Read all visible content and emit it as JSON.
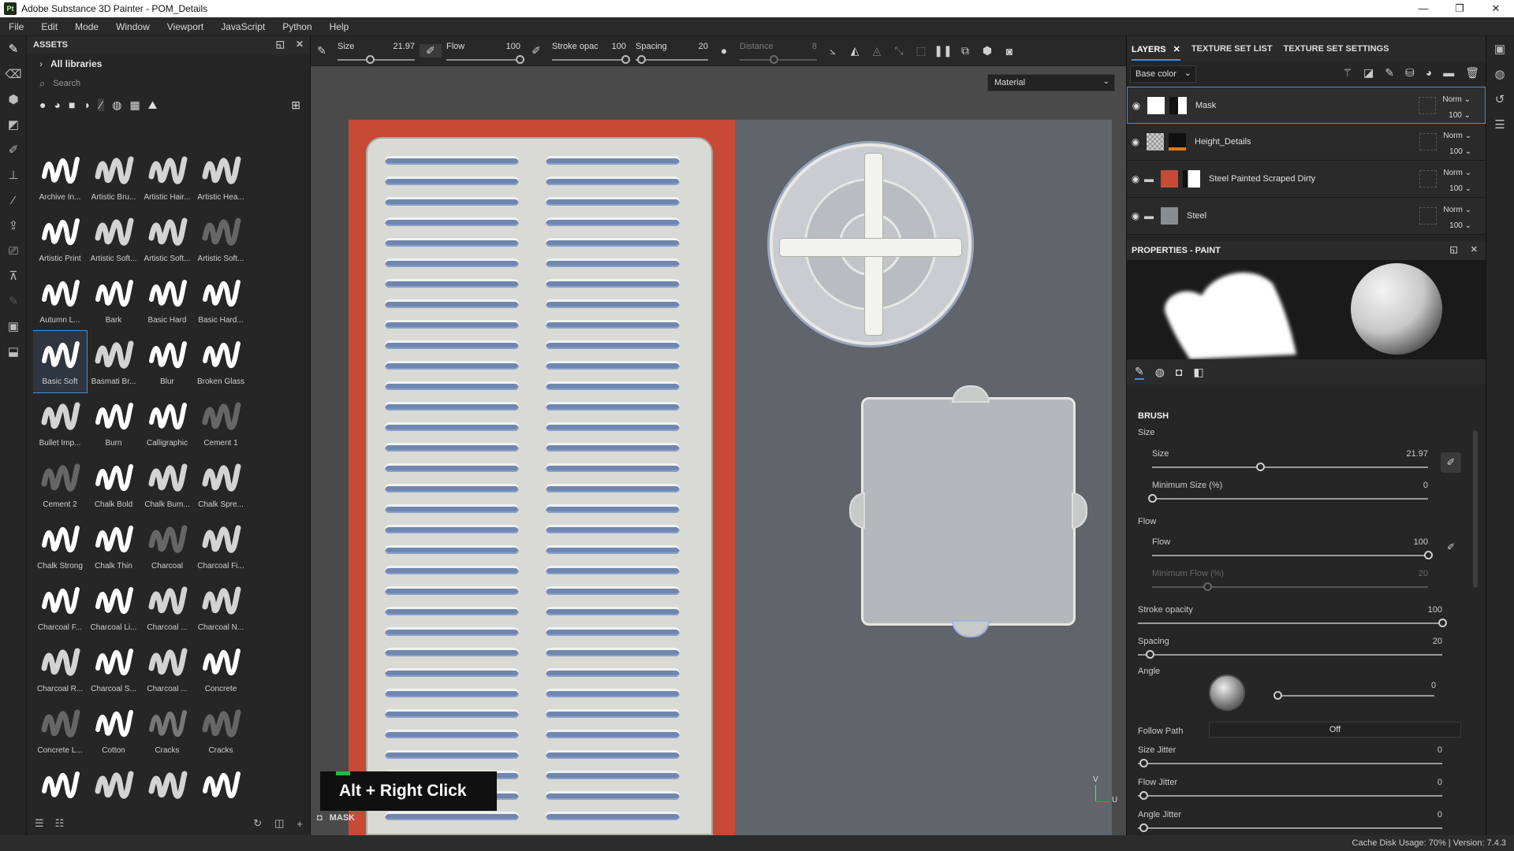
{
  "app": {
    "title": "Adobe Substance 3D Painter - POM_Details",
    "logo": "Pt"
  },
  "menu": [
    "File",
    "Edit",
    "Mode",
    "Window",
    "Viewport",
    "JavaScript",
    "Python",
    "Help"
  ],
  "assets": {
    "title": "ASSETS",
    "library": "All libraries",
    "search_placeholder": "Search",
    "brushes": [
      "Archive In...",
      "Artistic Bru...",
      "Artistic Hair...",
      "Artistic Hea...",
      "Artistic Print",
      "Artistic Soft...",
      "Artistic Soft...",
      "Artistic Soft...",
      "Autumn L...",
      "Bark",
      "Basic Hard",
      "Basic Hard...",
      "Basic Soft",
      "Basmati Br...",
      "Blur",
      "Broken Glass",
      "Bullet Imp...",
      "Burn",
      "Calligraphic",
      "Cement 1",
      "Cement 2",
      "Chalk Bold",
      "Chalk Bum...",
      "Chalk Spre...",
      "Chalk Strong",
      "Chalk Thin",
      "Charcoal",
      "Charcoal Fi...",
      "Charcoal F...",
      "Charcoal Li...",
      "Charcoal ...",
      "Charcoal N...",
      "Charcoal R...",
      "Charcoal S...",
      "Charcoal ...",
      "Concrete",
      "Concrete L...",
      "Cotton",
      "Cracks",
      "Cracks",
      "",
      "",
      "",
      ""
    ]
  },
  "toolbar": {
    "size_label": "Size",
    "size_value": "21.97",
    "flow_label": "Flow",
    "flow_value": "100",
    "stroke_label": "Stroke opac",
    "stroke_value": "100",
    "spacing_label": "Spacing",
    "spacing_value": "20",
    "distance_label": "Distance",
    "distance_value": "8"
  },
  "viewport": {
    "material_dropdown": "Material",
    "shortcut": "Alt + Right Click",
    "mask_label": "MASK",
    "axis_v": "V",
    "axis_u": "U"
  },
  "layers_panel": {
    "tabs": [
      "LAYERS",
      "TEXTURE SET LIST",
      "TEXTURE SET SETTINGS"
    ],
    "channel": "Base color",
    "layers": [
      {
        "name": "Mask",
        "blend": "Norm",
        "opacity": "100"
      },
      {
        "name": "Height_Details",
        "blend": "Norm",
        "opacity": "100"
      },
      {
        "name": "Steel Painted Scraped Dirty",
        "blend": "Norm",
        "opacity": "100"
      },
      {
        "name": "Steel",
        "blend": "Norm",
        "opacity": "100"
      }
    ]
  },
  "properties": {
    "title": "PROPERTIES - PAINT",
    "brush_section": "BRUSH",
    "size_group": "Size",
    "size": {
      "label": "Size",
      "value": "21.97",
      "fraction": 0.39
    },
    "min_size": {
      "label": "Minimum Size (%)",
      "value": "0",
      "fraction": 0.0
    },
    "flow_group": "Flow",
    "flow": {
      "label": "Flow",
      "value": "100",
      "fraction": 1.0
    },
    "min_flow": {
      "label": "Minimum Flow (%)",
      "value": "20",
      "fraction": 0.2
    },
    "stroke_opacity": {
      "label": "Stroke opacity",
      "value": "100",
      "fraction": 1.0
    },
    "spacing": {
      "label": "Spacing",
      "value": "20",
      "fraction": 0.04
    },
    "angle": {
      "label": "Angle",
      "value": "0"
    },
    "follow_path": {
      "label": "Follow Path",
      "value": "Off"
    },
    "size_jitter": {
      "label": "Size Jitter",
      "value": "0"
    },
    "flow_jitter": {
      "label": "Flow Jitter",
      "value": "0"
    },
    "angle_jitter": {
      "label": "Angle Jitter",
      "value": "0"
    }
  },
  "status": {
    "text": "Cache Disk Usage:   70% | Version: 7.4.3"
  }
}
